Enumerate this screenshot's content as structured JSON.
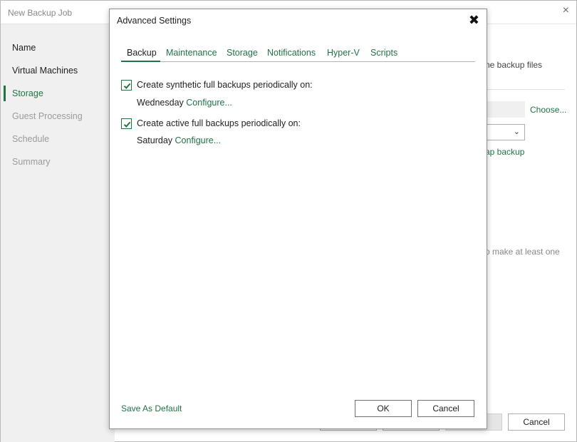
{
  "outer": {
    "title": "New Backup Job",
    "close_glyph": "×",
    "nav": [
      {
        "label": "Name",
        "state": "normal"
      },
      {
        "label": "Virtual Machines",
        "state": "normal"
      },
      {
        "label": "Storage",
        "state": "active"
      },
      {
        "label": "Guest Processing",
        "state": "disabled"
      },
      {
        "label": "Schedule",
        "state": "disabled"
      },
      {
        "label": "Summary",
        "state": "disabled"
      }
    ],
    "bg_text_backup_files": "ne backup files",
    "bg_choose_link": "Choose...",
    "bg_map_backup_link": "ap backup",
    "bg_text_make_one": "o make at least one",
    "bg_select_chevron": "⌄",
    "cancel_label": "Cancel"
  },
  "dialog": {
    "title": "Advanced Settings",
    "close_glyph": "✖",
    "tabs": [
      "Backup",
      "Maintenance",
      "Storage",
      "Notifications",
      "Hyper-V",
      "Scripts"
    ],
    "active_tab": "Backup",
    "synthetic": {
      "label": "Create synthetic full backups periodically on:",
      "checked": true,
      "day": "Wednesday",
      "configure": "Configure..."
    },
    "active_full": {
      "label": "Create active full backups periodically on:",
      "checked": true,
      "day": "Saturday",
      "configure": "Configure..."
    },
    "save_default": "Save As Default",
    "ok_label": "OK",
    "cancel_label": "Cancel"
  },
  "colors": {
    "accent": "#217346",
    "sidebar_bg": "#f0f0f0"
  }
}
